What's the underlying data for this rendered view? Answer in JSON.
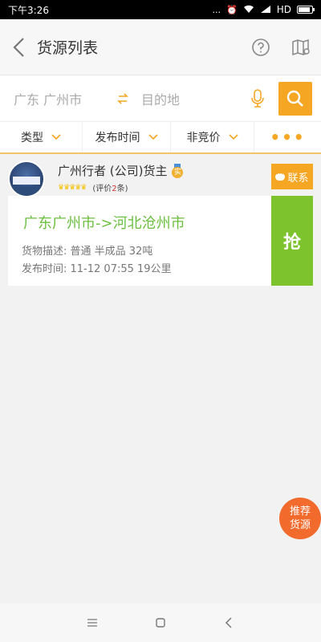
{
  "status_bar": {
    "time": "下午3:26",
    "dots": "...",
    "network": "HD"
  },
  "app_bar": {
    "title": "货源列表",
    "icons": [
      "back-icon",
      "help-icon",
      "map-icon"
    ]
  },
  "search": {
    "origin": "广东 广州市",
    "destination_placeholder": "目的地",
    "icons": [
      "swap-icon",
      "mic-icon",
      "search-icon"
    ]
  },
  "filters": {
    "type": "类型",
    "publish_time": "发布时间",
    "non_bidding": "非竞价",
    "more": "•••"
  },
  "listings": [
    {
      "owner_name": "广州行者 (公司)货主",
      "badge": "实",
      "reviews_prefix": "(评价",
      "reviews_count": "2",
      "reviews_suffix": "条)",
      "contact_label": "联系",
      "route": "广东广州市->河北沧州市",
      "cargo_desc": "货物描述: 普通 半成品 32吨",
      "publish_info": "发布时间: 11-12 07:55 19公里",
      "grab_label": "抢"
    }
  ],
  "recommend_label_1": "推荐",
  "recommend_label_2": "货源",
  "nav": {
    "icons": [
      "menu-icon",
      "home-icon",
      "back-nav-icon"
    ]
  },
  "colors": {
    "accent": "#f5a623",
    "green": "#7cc32e",
    "route_green": "#6cbf3e",
    "recommend": "#f26a2c"
  }
}
